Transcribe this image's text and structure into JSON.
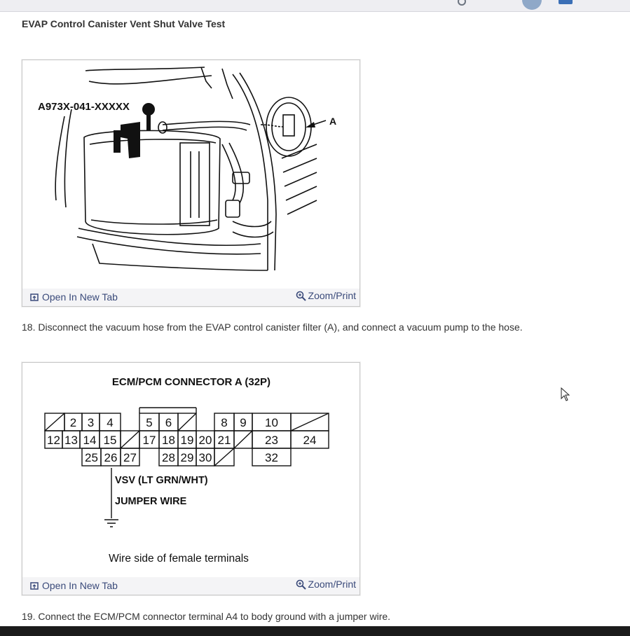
{
  "heading": "EVAP Control Canister Vent Shut Valve Test",
  "figure1": {
    "part_label": "A973X-041-XXXXX",
    "callout": "A",
    "open_tab_label": "Open In New Tab",
    "zoom_label": "Zoom/Print"
  },
  "step18": "18. Disconnect the vacuum hose from the EVAP control canister filter (A), and connect a vacuum pump to the hose.",
  "figure2": {
    "title": "ECM/PCM CONNECTOR A (32P)",
    "row1": [
      "2",
      "3",
      "4",
      "5",
      "6",
      "8",
      "9",
      "10"
    ],
    "row2": [
      "12",
      "13",
      "14",
      "15",
      "17",
      "18",
      "19",
      "20",
      "21",
      "23",
      "24"
    ],
    "row3": [
      "25",
      "26",
      "27",
      "28",
      "29",
      "30",
      "32"
    ],
    "vsv_label": "VSV (LT GRN/WHT)",
    "jumper_label": "JUMPER WIRE",
    "caption": "Wire side of female terminals",
    "open_tab_label": "Open In New Tab",
    "zoom_label": "Zoom/Print"
  },
  "step19": "19. Connect the ECM/PCM connector terminal A4 to body ground with a jumper wire.",
  "icons": [
    "open-in-new-tab-icon",
    "zoom-icon",
    "ground-symbol-icon",
    "mouse-cursor-icon"
  ]
}
